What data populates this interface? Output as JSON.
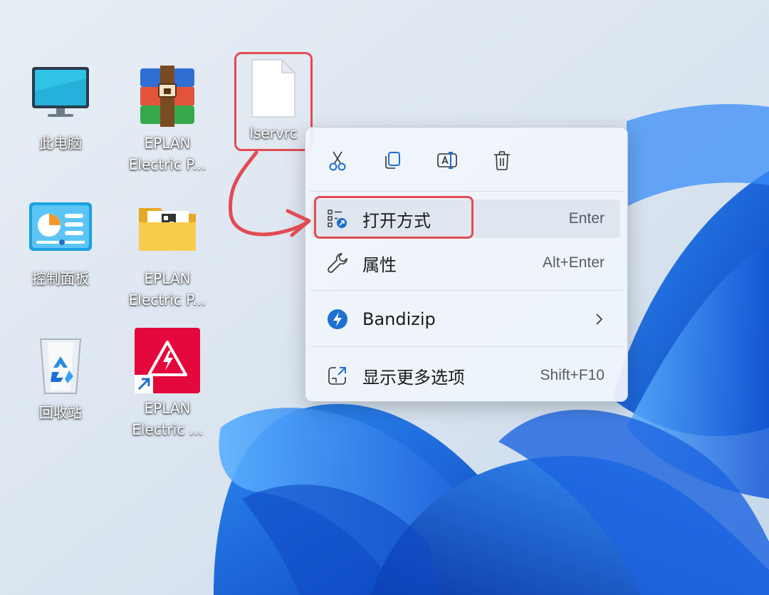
{
  "desktop": {
    "icons": [
      {
        "label": "此电脑",
        "icon": "monitor-icon"
      },
      {
        "label": "EPLAN\nElectric P...",
        "icon": "winrar-archive-icon"
      },
      {
        "label": "控制面板",
        "icon": "control-panel-icon"
      },
      {
        "label": "EPLAN\nElectric P...",
        "icon": "folder-icon"
      },
      {
        "label": "回收站",
        "icon": "recycle-bin-icon"
      },
      {
        "label": "EPLAN\nElectric ...",
        "icon": "eplan-shortcut-icon"
      },
      {
        "label": "lservrc",
        "icon": "blank-file-icon"
      }
    ]
  },
  "context_menu": {
    "toolbar": [
      {
        "icon": "cut-icon",
        "label": "剪切"
      },
      {
        "icon": "copy-icon",
        "label": "复制"
      },
      {
        "icon": "rename-icon",
        "label": "重命名"
      },
      {
        "icon": "delete-icon",
        "label": "删除"
      }
    ],
    "items": [
      {
        "label": "打开方式",
        "shortcut": "Enter",
        "icon": "open-with-icon"
      },
      {
        "label": "属性",
        "shortcut": "Alt+Enter",
        "icon": "wrench-icon"
      },
      {
        "label": "Bandizip",
        "shortcut": "",
        "icon": "bandizip-icon",
        "submenu": true
      },
      {
        "label": "显示更多选项",
        "shortcut": "Shift+F10",
        "icon": "show-more-icon"
      }
    ]
  },
  "colors": {
    "annotation": "#e24b53",
    "accent_blue": "#1f6fd1",
    "wallpaper_bg": "#dde7f2"
  }
}
